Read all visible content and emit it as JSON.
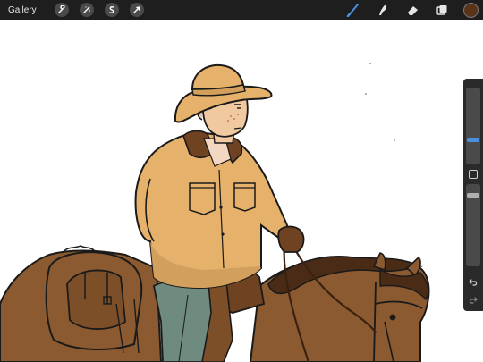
{
  "topbar": {
    "gallery_label": "Gallery",
    "left_tools": [
      {
        "name": "actions-icon"
      },
      {
        "name": "adjustments-icon"
      },
      {
        "name": "selection-icon"
      },
      {
        "name": "transform-icon"
      }
    ],
    "right_tools": [
      {
        "name": "brush-icon",
        "active": true
      },
      {
        "name": "smudge-icon"
      },
      {
        "name": "eraser-icon"
      },
      {
        "name": "layers-icon"
      }
    ],
    "current_color": "#5a3418",
    "active_color": "#4a8fe0"
  },
  "sidebar": {
    "brush_size_level": 0.75,
    "opacity_level": 0.5,
    "undo_icon": "undo-icon",
    "redo_icon": "redo-icon"
  }
}
